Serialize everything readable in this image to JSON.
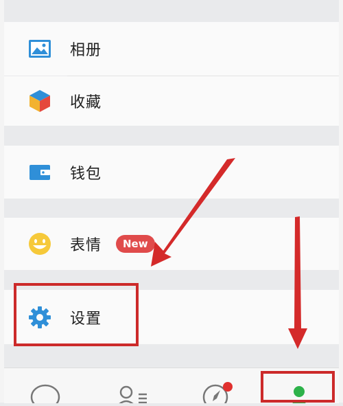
{
  "menu": {
    "album": {
      "label": "相册",
      "icon": "photo-album-icon"
    },
    "favorites": {
      "label": "收藏",
      "icon": "favorites-cube-icon"
    },
    "wallet": {
      "label": "钱包",
      "icon": "wallet-icon"
    },
    "stickers": {
      "label": "表情",
      "icon": "smiley-icon",
      "badge": "New"
    },
    "settings": {
      "label": "设置",
      "icon": "gear-icon"
    }
  },
  "tabbar": {
    "tabs": [
      {
        "name": "chats",
        "icon": "chat-bubble-icon"
      },
      {
        "name": "contacts",
        "icon": "contacts-icon"
      },
      {
        "name": "discover",
        "icon": "compass-icon",
        "has_dot": true
      },
      {
        "name": "me",
        "icon": "me-icon",
        "active": true
      }
    ]
  },
  "colors": {
    "accent_blue": "#2f8fd8",
    "badge_red": "#e04b4b",
    "highlight_red": "#cc2a2a",
    "active_green": "#2db24a"
  }
}
